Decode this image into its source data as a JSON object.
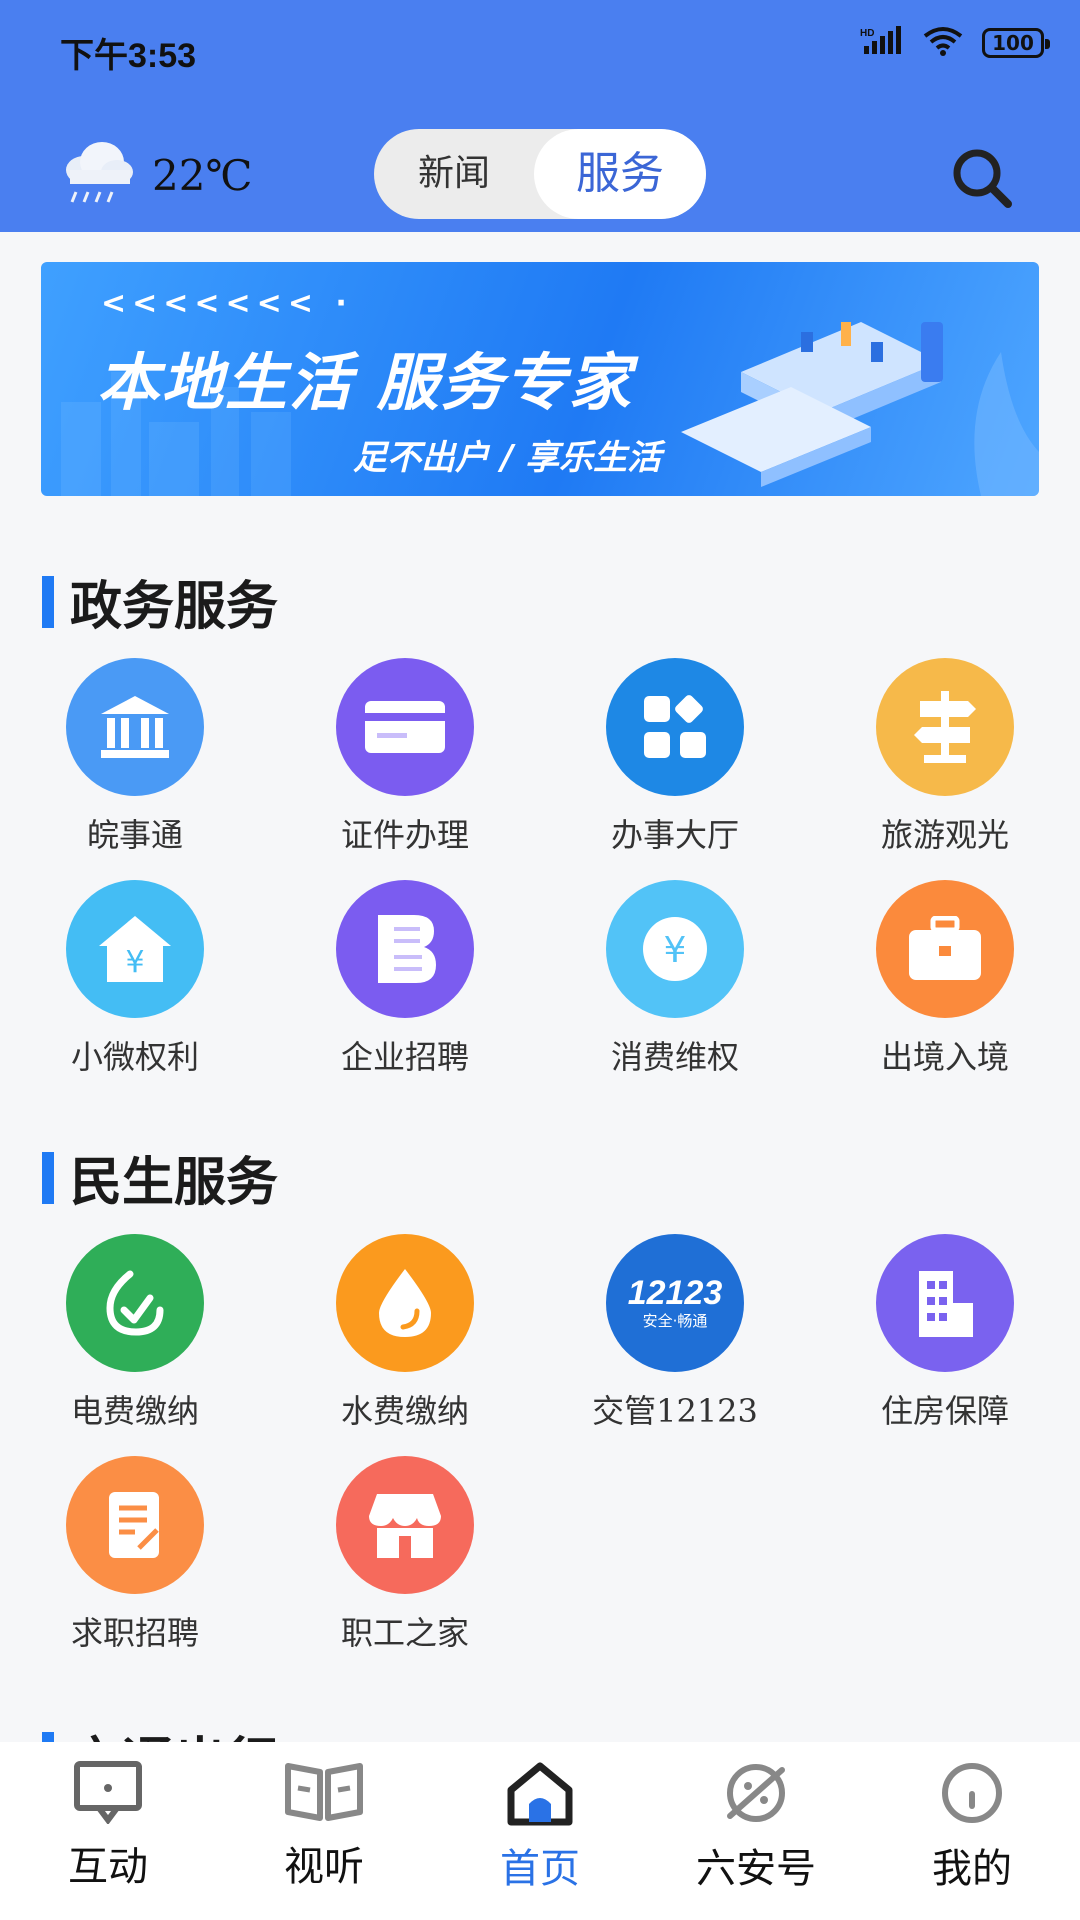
{
  "status_bar": {
    "time": "下午3:53",
    "battery": "100"
  },
  "header": {
    "weather_temp": "22℃",
    "tabs": [
      {
        "label": "新闻"
      },
      {
        "label": "服务"
      }
    ],
    "active_tab": "服务"
  },
  "banner": {
    "chevrons": "<<<<<<< ·",
    "title": "本地生活 服务专家",
    "subtitle": "足不出户 / 享乐生活"
  },
  "sections": [
    {
      "title": "政务服务",
      "items": [
        {
          "label": "皖事通",
          "icon": "bank-icon",
          "color": "#4a9af5"
        },
        {
          "label": "证件办理",
          "icon": "card-icon",
          "color": "#7b5cf0"
        },
        {
          "label": "办事大厅",
          "icon": "grid-icon",
          "color": "#1e88e5"
        },
        {
          "label": "旅游观光",
          "icon": "signpost-icon",
          "color": "#f6b94a"
        },
        {
          "label": "小微权利",
          "icon": "house-yen-icon",
          "color": "#44bdf4"
        },
        {
          "label": "企业招聘",
          "icon": "document-icon",
          "color": "#7b5cf0"
        },
        {
          "label": "消费维权",
          "icon": "yen-icon",
          "color": "#52c3f7"
        },
        {
          "label": "出境入境",
          "icon": "briefcase-icon",
          "color": "#fb8a3c"
        }
      ]
    },
    {
      "title": "民生服务",
      "items": [
        {
          "label": "电费缴纳",
          "icon": "electric-icon",
          "color": "#2fae58"
        },
        {
          "label": "水费缴纳",
          "icon": "water-drop-icon",
          "color": "#fb9a1e"
        },
        {
          "label": "交管12123",
          "icon": "traffic-12123-icon",
          "color": "#1f6fd6",
          "logo_text": "12123",
          "logo_sub": "安全·畅通"
        },
        {
          "label": "住房保障",
          "icon": "building-icon",
          "color": "#7a62ef"
        },
        {
          "label": "求职招聘",
          "icon": "resume-icon",
          "color": "#fb8e45"
        },
        {
          "label": "职工之家",
          "icon": "shop-icon",
          "color": "#f66a5c"
        }
      ]
    },
    {
      "title": "交通出行"
    }
  ],
  "bottom_nav": [
    {
      "label": "互动",
      "icon": "chat-board-icon"
    },
    {
      "label": "视听",
      "icon": "book-icon"
    },
    {
      "label": "首页",
      "icon": "home-icon",
      "active": true
    },
    {
      "label": "六安号",
      "icon": "planet-icon"
    },
    {
      "label": "我的",
      "icon": "profile-icon"
    }
  ],
  "colors": {
    "header_bg": "#4a7ff0",
    "accent": "#1f7af4",
    "active_nav": "#2a72e6"
  }
}
